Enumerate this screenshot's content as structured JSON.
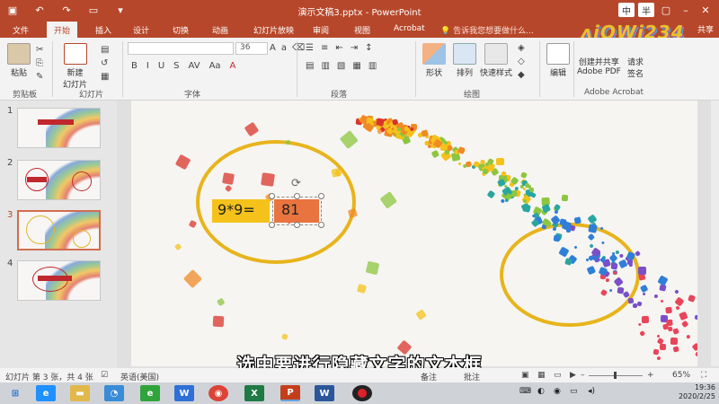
{
  "window": {
    "title": "演示文稿3.pptx - PowerPoint",
    "ime_chinese": "中",
    "ime_half": "半"
  },
  "tabs": [
    {
      "label": "文件"
    },
    {
      "label": "开始"
    },
    {
      "label": "插入"
    },
    {
      "label": "设计"
    },
    {
      "label": "切换"
    },
    {
      "label": "动画"
    },
    {
      "label": "幻灯片放映"
    },
    {
      "label": "审阅"
    },
    {
      "label": "视图"
    },
    {
      "label": "Acrobat"
    }
  ],
  "tell_me": "告诉我您想要做什么...",
  "share": "共享",
  "brand": "ʌiOWi234",
  "ribbon": {
    "paste": "粘贴",
    "new_slide": "新建\n幻灯片",
    "font_size": "36",
    "shape": "形状",
    "arrange": "排列",
    "quick_styles": "快速样式",
    "edit": "编辑",
    "create_share": "创建并共享\nAdobe PDF",
    "request_sign": "请求\n签名",
    "groups": {
      "clipboard": "剪贴板",
      "slides": "幻灯片",
      "font": "字体",
      "paragraph": "段落",
      "drawing": "绘图",
      "acrobat": "Adobe Acrobat"
    }
  },
  "slides_panel": {
    "numbers": [
      "1",
      "2",
      "3",
      "4"
    ],
    "active_index": 3
  },
  "slide": {
    "equation": "9*9=",
    "answer": "81"
  },
  "subtitle": "选中要进行隐藏文字的文本框",
  "status": {
    "slide_info": "幻灯片 第 3 张，共 4 张",
    "language": "英语(美国)",
    "notes": "备注",
    "comments": "批注",
    "zoom": "65%"
  },
  "clock": {
    "time": "19:36",
    "date": "2020/2/25"
  },
  "colors": {
    "accent": "#b7472a",
    "gold": "#e8b41c",
    "equation_fill": "#f4c21a",
    "answer_fill": "#e9743f"
  }
}
